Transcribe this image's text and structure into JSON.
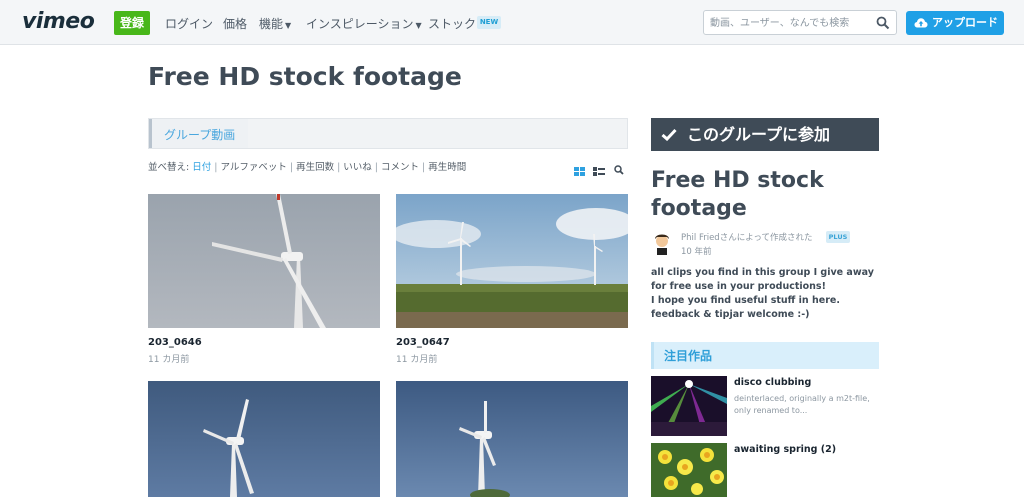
{
  "header": {
    "logo": "vimeo",
    "join_label": "登録",
    "nav": [
      {
        "label": "ログイン",
        "has_menu": false
      },
      {
        "label": "価格",
        "has_menu": false
      },
      {
        "label": "機能",
        "has_menu": true
      },
      {
        "label": "インスピレーション",
        "has_menu": true
      },
      {
        "label": "ストック",
        "has_menu": false
      }
    ],
    "new_badge": "NEW",
    "search_placeholder": "動画、ユーザー、なんでも検索",
    "upload_label": "アップロード"
  },
  "page": {
    "title": "Free HD stock footage"
  },
  "tabs": [
    {
      "label": "グループ動画",
      "active": true
    }
  ],
  "sort": {
    "prefix": "並べ替え:",
    "options": [
      {
        "label": "日付",
        "active": true
      },
      {
        "label": "アルファベット",
        "active": false
      },
      {
        "label": "再生回数",
        "active": false
      },
      {
        "label": "いいね",
        "active": false
      },
      {
        "label": "コメント",
        "active": false
      },
      {
        "label": "再生時間",
        "active": false
      }
    ]
  },
  "clips": [
    {
      "title": "203_0646",
      "age": "11 カ月前"
    },
    {
      "title": "203_0647",
      "age": "11 カ月前"
    },
    {
      "title": "",
      "age": ""
    },
    {
      "title": "",
      "age": ""
    }
  ],
  "sidebar": {
    "join_label": "このグループに参加",
    "group_title": "Free HD stock footage",
    "creator_text": "Phil Friedさんによって作成された",
    "plus_badge": "PLUS",
    "created_age": "10 年前",
    "description_lines": [
      "all clips you find in this group I give away for free use in your productions!",
      "I hope you find useful stuff in here. feedback & tipjar welcome :-)"
    ],
    "featured_label": "注目作品",
    "featured": [
      {
        "title": "disco clubbing",
        "desc": "deinterlaced, originally a m2t-file, only renamed to..."
      },
      {
        "title": "awaiting spring (2)",
        "desc": ""
      }
    ]
  },
  "colors": {
    "accent_blue": "#1fa0e6",
    "join_green": "#48b71a",
    "dark_slate": "#3f4b57"
  }
}
